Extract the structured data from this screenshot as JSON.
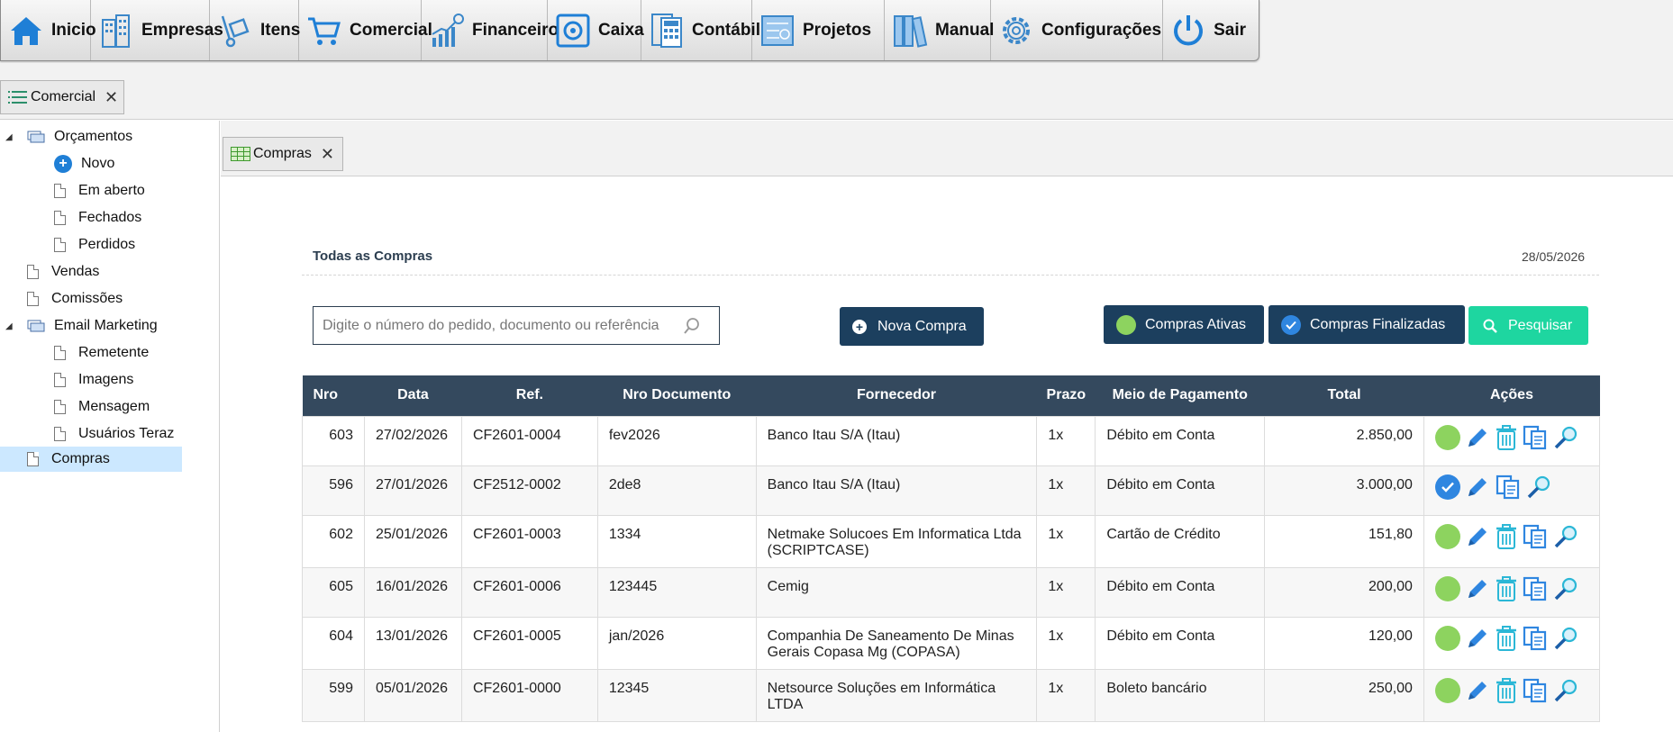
{
  "menu": [
    {
      "label": "Inicio",
      "icon": "home-icon"
    },
    {
      "label": "Empresas",
      "icon": "buildings-icon"
    },
    {
      "label": "Itens",
      "icon": "hand-truck-icon"
    },
    {
      "label": "Comercial",
      "icon": "cart-icon"
    },
    {
      "label": "Financeiro",
      "icon": "chart-growth-icon"
    },
    {
      "label": "Caixa",
      "icon": "safe-icon"
    },
    {
      "label": "Contábil",
      "icon": "calculator-icon"
    },
    {
      "label": "Projetos",
      "icon": "blueprint-icon"
    },
    {
      "label": "Manual",
      "icon": "binders-icon"
    },
    {
      "label": "Configurações",
      "icon": "gear-icon"
    },
    {
      "label": "Sair",
      "icon": "power-icon"
    }
  ],
  "outer_tab": {
    "label": "Comercial"
  },
  "inner_tab": {
    "label": "Compras"
  },
  "sidebar": {
    "orcamentos": "Orçamentos",
    "novo": "Novo",
    "em_aberto": "Em aberto",
    "fechados": "Fechados",
    "perdidos": "Perdidos",
    "vendas": "Vendas",
    "comissoes": "Comissões",
    "email_marketing": "Email Marketing",
    "remetente": "Remetente",
    "imagens": "Imagens",
    "mensagem": "Mensagem",
    "usuarios_teraz": "Usuários Teraz",
    "compras": "Compras"
  },
  "panel": {
    "title": "Todas as Compras",
    "date": "28/05/2026",
    "search_placeholder": "Digite o número do pedido, documento ou referência",
    "btn_nova": "Nova Compra",
    "btn_ativas": "Compras Ativas",
    "btn_finalizadas": "Compras Finalizadas",
    "btn_pesquisar": "Pesquisar"
  },
  "table": {
    "headers": [
      "Nro",
      "Data",
      "Ref.",
      "Nro Documento",
      "Fornecedor",
      "Prazo",
      "Meio de Pagamento",
      "Total",
      "Ações"
    ],
    "rows": [
      {
        "nro": "603",
        "data": "27/02/2026",
        "ref": "CF2601-0004",
        "doc": "fev2026",
        "fornecedor": "Banco Itau S/A (Itau)",
        "prazo": "1x",
        "meio": "Débito em Conta",
        "total": "2.850,00",
        "status": "active"
      },
      {
        "nro": "596",
        "data": "27/01/2026",
        "ref": "CF2512-0002",
        "doc": "2de8",
        "fornecedor": "Banco Itau S/A (Itau)",
        "prazo": "1x",
        "meio": "Débito em Conta",
        "total": "3.000,00",
        "status": "finalized"
      },
      {
        "nro": "602",
        "data": "25/01/2026",
        "ref": "CF2601-0003",
        "doc": "1334",
        "fornecedor": "Netmake Solucoes Em Informatica Ltda (SCRIPTCASE)",
        "prazo": "1x",
        "meio": "Cartão de Crédito",
        "total": "151,80",
        "status": "active"
      },
      {
        "nro": "605",
        "data": "16/01/2026",
        "ref": "CF2601-0006",
        "doc": "123445",
        "fornecedor": "Cemig",
        "prazo": "1x",
        "meio": "Débito em Conta",
        "total": "200,00",
        "status": "active"
      },
      {
        "nro": "604",
        "data": "13/01/2026",
        "ref": "CF2601-0005",
        "doc": "jan/2026",
        "fornecedor": "Companhia De Saneamento De Minas Gerais Copasa Mg (COPASA)",
        "prazo": "1x",
        "meio": "Débito em Conta",
        "total": "120,00",
        "status": "active"
      },
      {
        "nro": "599",
        "data": "05/01/2026",
        "ref": "CF2601-0000",
        "doc": "12345",
        "fornecedor": "Netsource Soluções em Informática LTDA",
        "prazo": "1x",
        "meio": "Boleto bancário",
        "total": "250,00",
        "status": "active"
      }
    ]
  },
  "colors": {
    "header_bg": "#34495e",
    "button_dark": "#1c3f5e",
    "button_green": "#1ed6a0",
    "status_green": "#8dd35f",
    "status_blue": "#2f86e0",
    "icon_blue": "#2f86e0",
    "icon_cyan": "#2bb7d6"
  }
}
